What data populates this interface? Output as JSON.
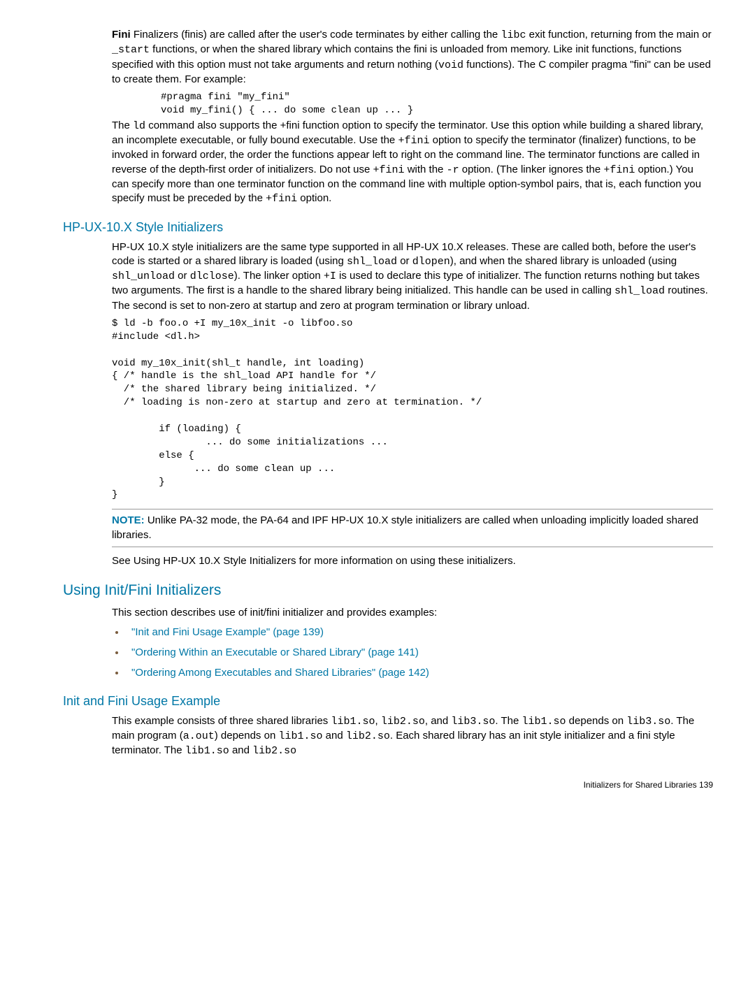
{
  "p1": "Fini Finalizers (finis) are called after the user's code terminates by either calling the libc exit function, returning from the main or _start functions, or when the shared library which contains the fini is unloaded from memory. Like init functions, functions specified with this option must not take arguments and return nothing (void functions). The C compiler pragma \"fini\" can be used to create them. For example:",
  "p1_bold": "Fini",
  "p1_rest_a": " Finalizers (finis) are called after the user's code terminates by either calling the ",
  "p1_code_a": "libc",
  "p1_rest_b": " exit function, returning from the main or ",
  "p1_code_b": "_start",
  "p1_rest_c": " functions, or when the shared library which contains the fini is unloaded from memory. Like init functions, functions specified with this option must not take arguments and return nothing (",
  "p1_code_c": "void",
  "p1_rest_d": " functions). The C compiler pragma \"fini\" can be used to create them. For example:",
  "code1": "#pragma fini \"my_fini\"\nvoid my_fini() { ... do some clean up ... }",
  "p2_a": "The ",
  "p2_code_a": "ld",
  "p2_b": " command also supports the +fini function option to specify the terminator. Use this option while building a shared library, an incomplete executable, or fully bound executable. Use the ",
  "p2_code_b": "+fini",
  "p2_c": " option to specify the terminator (finalizer) functions, to be invoked in forward order, the order the functions appear left to right on the command line. The terminator functions are called in reverse of the depth-first order of initializers. Do not use ",
  "p2_code_c": "+fini",
  "p2_d": " with the ",
  "p2_code_d": "-r",
  "p2_e": " option. (The linker ignores the ",
  "p2_code_e": "+fini",
  "p2_f": " option.) You can specify more than one terminator function on the command line with multiple option-symbol pairs, that is, each function you specify must be preceded by the ",
  "p2_code_f": "+fini",
  "p2_g": " option.",
  "h3_1": "HP-UX-10.X Style Initializers",
  "p3_a": "HP-UX 10.X style initializers are the same type supported in all HP-UX 10.X releases. These are called both, before the user's code is started or a shared library is loaded (using ",
  "p3_code_a": "shl_load",
  "p3_b": " or ",
  "p3_code_b": "dlopen",
  "p3_c": "), and when the shared library is unloaded (using ",
  "p3_code_c": "shl_unload",
  "p3_d": " or ",
  "p3_code_d": "dlclose",
  "p3_e": "). The linker option ",
  "p3_code_e": "+I",
  "p3_f": " is used to declare this type of initializer. The function returns nothing but takes two arguments. The first is a handle to the shared library being initialized. This handle can be used in calling ",
  "p3_code_f": "shl_load",
  "p3_g": " routines. The second is set to non-zero at startup and zero at program termination or library unload.",
  "code2": "$ ld -b foo.o +I my_10x_init -o libfoo.so\n#include <dl.h>\n\nvoid my_10x_init(shl_t handle, int loading)\n{ /* handle is the shl_load API handle for */\n  /* the shared library being initialized. */\n  /* loading is non-zero at startup and zero at termination. */\n\n        if (loading) {\n                ... do some initializations ...\n        else {\n              ... do some clean up ...\n        }\n}",
  "note_label": "NOTE:",
  "note_text": "   Unlike PA-32 mode, the PA-64 and IPF HP-UX 10.X style initializers are called when unloading implicitly loaded shared libraries.",
  "p4": "See Using HP-UX 10.X Style Initializers for more information on using these initializers.",
  "h2_1": "Using Init/Fini Initializers",
  "p5": "This section describes use of init/fini initializer and provides examples:",
  "li1": "\"Init and Fini Usage Example\" (page 139)",
  "li2": "\"Ordering Within an Executable or Shared Library\" (page 141)",
  "li3": "\"Ordering Among Executables and Shared Libraries\" (page 142)",
  "h3_2": "Init and Fini Usage Example",
  "p6_a": "This example consists of three shared libraries ",
  "p6_code_a": "lib1.so",
  "p6_b": ", ",
  "p6_code_b": "lib2.so",
  "p6_c": ", and ",
  "p6_code_c": "lib3.so",
  "p6_d": ". The  ",
  "p6_code_d": "lib1.so",
  "p6_e": " depends on ",
  "p6_code_e": "lib3.so",
  "p6_f": ". The main program (",
  "p6_code_f": "a.out",
  "p6_g": ") depends on ",
  "p6_code_g": "lib1.so",
  "p6_h": " and ",
  "p6_code_h": "lib2.so",
  "p6_i": ". Each shared library has an init style initializer and a fini style terminator. The ",
  "p6_code_i": "lib1.so",
  "p6_j": " and ",
  "p6_code_j": "lib2.so",
  "footer": "Initializers for Shared Libraries   139"
}
